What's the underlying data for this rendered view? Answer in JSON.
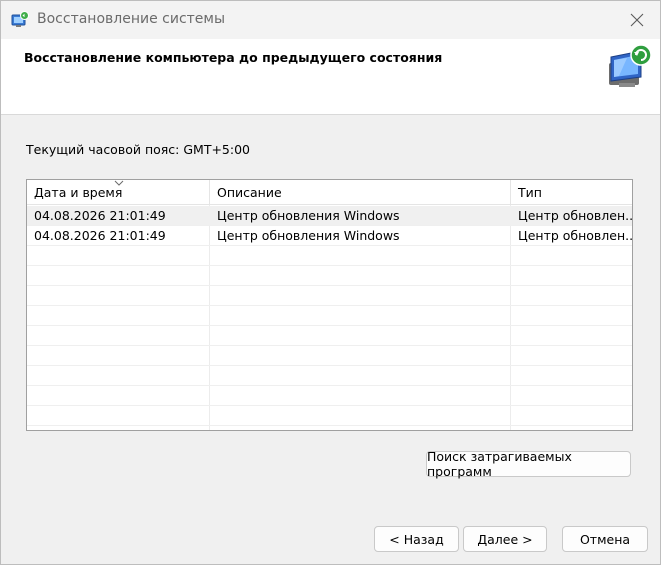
{
  "window": {
    "title": "Восстановление системы"
  },
  "header": {
    "title": "Восстановление компьютера до предыдущего состояния"
  },
  "timezone": {
    "label": "Текущий часовой пояс: GMT+5:00"
  },
  "table": {
    "columns": [
      "Дата и время",
      "Описание",
      "Тип"
    ],
    "rows": [
      {
        "datetime": "04.08.2026 21:01:49",
        "description": "Центр обновления Windows",
        "type": "Центр обновлен..."
      },
      {
        "datetime": "04.08.2026 21:01:49",
        "description": "Центр обновления Windows",
        "type": "Центр обновлен..."
      }
    ]
  },
  "buttons": {
    "scan": "Поиск затрагиваемых программ",
    "back": "< Назад",
    "next": "Далее >",
    "cancel": "Отмена"
  },
  "colors": {
    "accent": "#0a64c8",
    "selected_row": "#f0f0f0"
  },
  "icons": {
    "title": "system-restore-icon",
    "header": "computer-restore-icon",
    "close": "close-icon",
    "sort": "chevron-down-icon"
  }
}
